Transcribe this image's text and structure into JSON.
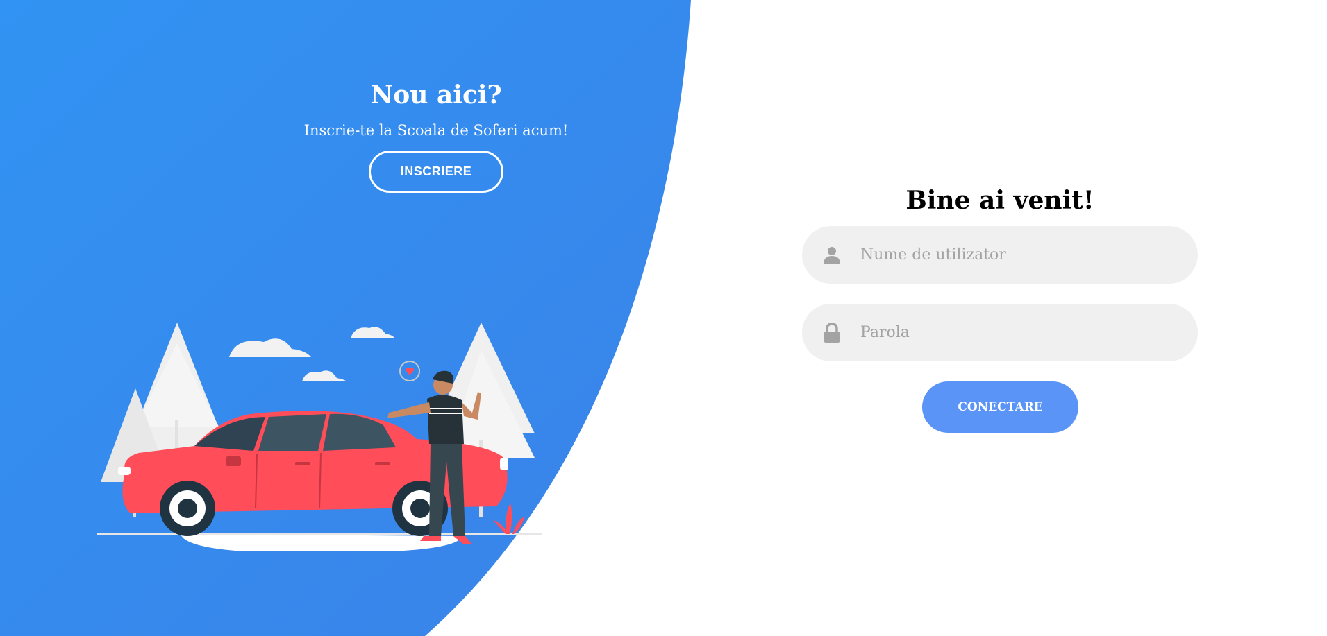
{
  "signup_panel": {
    "title": "Nou aici?",
    "subtitle": "Inscrie-te la Scoala de Soferi acum!",
    "button_label": "INSCRIERE"
  },
  "login_form": {
    "title": "Bine ai venit!",
    "username": {
      "placeholder": "Nume de utilizator",
      "value": "",
      "icon": "user-icon"
    },
    "password": {
      "placeholder": "Parola",
      "value": "",
      "icon": "lock-icon"
    },
    "submit_label": "CONECTARE"
  },
  "colors": {
    "panel_gradient_start": "#3193f3",
    "panel_gradient_end": "#3b82e8",
    "primary_button": "#5b94f7",
    "input_background": "#f0f0f0",
    "car": "#ff4d5a"
  }
}
